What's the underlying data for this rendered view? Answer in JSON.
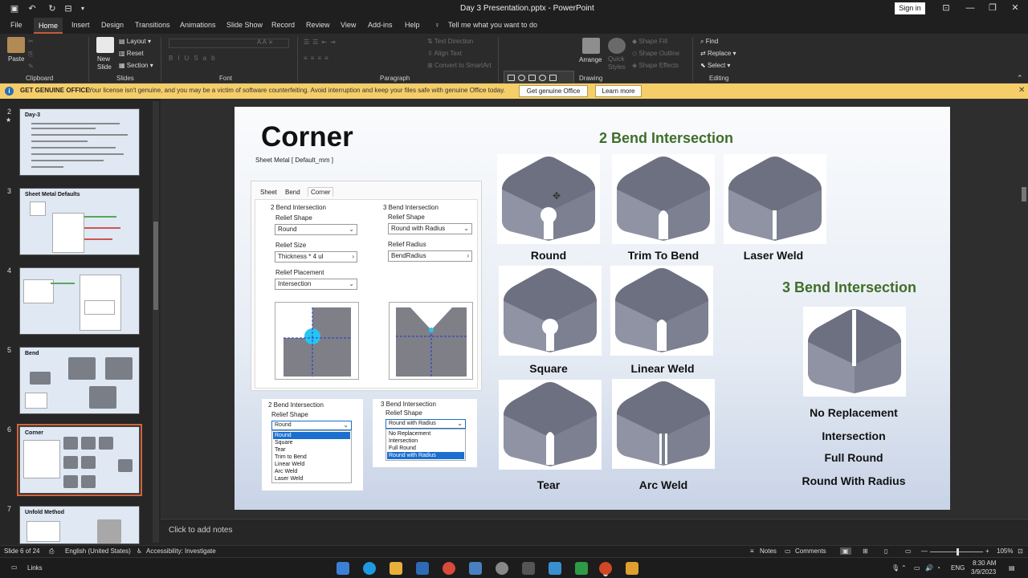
{
  "titlebar": {
    "title": "Day 3 Presentation.pptx",
    "app": "PowerPoint",
    "signin": "Sign in"
  },
  "tabs": [
    "File",
    "Home",
    "Insert",
    "Design",
    "Transitions",
    "Animations",
    "Slide Show",
    "Record",
    "Review",
    "View",
    "Add-ins",
    "Help"
  ],
  "active_tab": "Home",
  "tell_me": "Tell me what you want to do",
  "ribbon": {
    "groups": [
      "Clipboard",
      "Slides",
      "Font",
      "Paragraph",
      "Drawing",
      "Editing"
    ],
    "paste": "Paste",
    "new_slide": "New\nSlide",
    "layout": "Layout",
    "reset": "Reset",
    "section": "Section",
    "text_direction": "Text Direction",
    "align_text": "Align Text",
    "convert_smartart": "Convert to SmartArt",
    "arrange": "Arrange",
    "quick_styles": "Quick\nStyles",
    "shape_fill": "Shape Fill",
    "shape_outline": "Shape Outline",
    "shape_effects": "Shape Effects",
    "find": "Find",
    "replace": "Replace",
    "select": "Select"
  },
  "infobar": {
    "bold": "GET GENUINE OFFICE",
    "message": "Your license isn't genuine, and you may be a victim of software counterfeiting. Avoid interruption and keep your files safe with genuine Office today.",
    "btn1": "Get genuine Office",
    "btn2": "Learn more"
  },
  "thumbs": [
    {
      "num": "2",
      "title": "Day-3"
    },
    {
      "num": "3",
      "title": "Sheet Metal Defaults"
    },
    {
      "num": "4",
      "title": ""
    },
    {
      "num": "5",
      "title": "Bend"
    },
    {
      "num": "6",
      "title": "Corner"
    },
    {
      "num": "7",
      "title": "Unfold Method"
    }
  ],
  "slide": {
    "title": "Corner",
    "h2bend": "2 Bend Intersection",
    "h3bend": "3 Bend Intersection",
    "captions": [
      "Round",
      "Trim To Bend",
      "Laser Weld",
      "Square",
      "Linear Weld",
      "Tear",
      "Arc Weld"
    ],
    "three_bend_list": [
      "No Replacement",
      "Intersection",
      "Full Round",
      "Round With Radius"
    ],
    "dialog": {
      "title": "Sheet Metal [ Default_mm ]",
      "tabs": [
        "Sheet",
        "Bend",
        "Corner"
      ],
      "left_heading": "2 Bend Intersection",
      "right_heading": "3 Bend Intersection",
      "relief_shape": "Relief Shape",
      "relief_size": "Relief Size",
      "relief_placement": "Relief Placement",
      "relief_radius": "Relief Radius",
      "shape_val": "Round",
      "size_val": "Thickness * 4 ul",
      "placement_val": "Intersection",
      "r_shape_val": "Round with Radius",
      "r_radius_val": "BendRadius"
    },
    "list2": {
      "heading": "2 Bend Intersection",
      "label": "Relief Shape",
      "value": "Round",
      "options": [
        "Round",
        "Square",
        "Tear",
        "Trim to Bend",
        "Linear Weld",
        "Arc Weld",
        "Laser Weld"
      ]
    },
    "list3": {
      "heading": "3 Bend Intersection",
      "label": "Relief Shape",
      "value": "Round with Radius",
      "options": [
        "No Replacement",
        "Intersection",
        "Full Round",
        "Round with Radius"
      ]
    }
  },
  "notes_placeholder": "Click to add notes",
  "status": {
    "slide": "Slide 6 of 24",
    "language": "English (United States)",
    "accessibility": "Accessibility: Investigate",
    "notes": "Notes",
    "comments": "Comments",
    "zoom": "105%"
  },
  "taskbar": {
    "links": "Links",
    "lang": "ENG",
    "time": "8:30 AM",
    "date": "3/9/2023"
  },
  "colors": {
    "accent": "#c55a3a",
    "heading_green": "#3f6e29",
    "warn_bar": "#f5ce6a",
    "sheet": "#7c8090",
    "selection": "#1a6fcf"
  }
}
